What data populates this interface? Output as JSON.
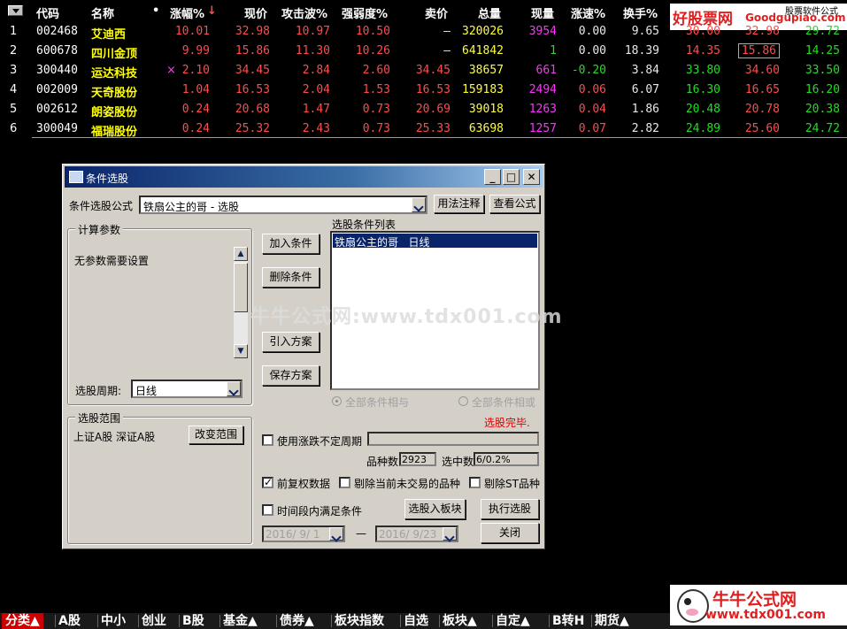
{
  "table": {
    "headers": {
      "code": "代码",
      "name": "名称",
      "dot": "•",
      "change_pct": "涨幅%",
      "sort_mark": "↓",
      "price": "现价",
      "attack_wave": "攻击波%",
      "strength": "强弱度%",
      "ask": "卖价",
      "volume": "总量",
      "cur_volume": "现量",
      "speed": "涨速%",
      "turnover": "换手%"
    },
    "rows": [
      {
        "idx": "1",
        "code": "002468",
        "name": "艾迪西",
        "mark": "",
        "chg": "10.01",
        "price": "32.98",
        "attack": "10.97",
        "strength": "10.50",
        "ask": "—",
        "vol": "320026",
        "cur": "3954",
        "speed": "0.00",
        "turn": "9.65",
        "c1": "30.00",
        "c2": "32.98",
        "c3": "29.72"
      },
      {
        "idx": "2",
        "code": "600678",
        "name": "四川金顶",
        "mark": "",
        "chg": "9.99",
        "price": "15.86",
        "attack": "11.30",
        "strength": "10.26",
        "ask": "—",
        "vol": "641842",
        "cur": "1",
        "speed": "0.00",
        "turn": "18.39",
        "c1": "14.35",
        "c2": "15.86",
        "c3": "14.25"
      },
      {
        "idx": "3",
        "code": "300440",
        "name": "运达科技",
        "mark": "×",
        "chg": "2.10",
        "price": "34.45",
        "attack": "2.84",
        "strength": "2.60",
        "ask": "34.45",
        "vol": "38657",
        "cur": "661",
        "speed": "-0.20",
        "turn": "3.84",
        "c1": "33.80",
        "c2": "34.60",
        "c3": "33.50"
      },
      {
        "idx": "4",
        "code": "002009",
        "name": "天奇股份",
        "mark": "",
        "chg": "1.04",
        "price": "16.53",
        "attack": "2.04",
        "strength": "1.53",
        "ask": "16.53",
        "vol": "159183",
        "cur": "2494",
        "speed": "0.06",
        "turn": "6.07",
        "c1": "16.30",
        "c2": "16.65",
        "c3": "16.20"
      },
      {
        "idx": "5",
        "code": "002612",
        "name": "朗姿股份",
        "mark": "",
        "chg": "0.24",
        "price": "20.68",
        "attack": "1.47",
        "strength": "0.73",
        "ask": "20.69",
        "vol": "39018",
        "cur": "1263",
        "speed": "0.04",
        "turn": "1.86",
        "c1": "20.48",
        "c2": "20.78",
        "c3": "20.38"
      },
      {
        "idx": "6",
        "code": "300049",
        "name": "福瑞股份",
        "mark": "",
        "chg": "0.24",
        "price": "25.32",
        "attack": "2.43",
        "strength": "0.73",
        "ask": "25.33",
        "vol": "63698",
        "cur": "1257",
        "speed": "0.07",
        "turn": "2.82",
        "c1": "24.89",
        "c2": "25.60",
        "c3": "24.72"
      }
    ]
  },
  "top_logo": {
    "brand": "好股票网",
    "domain": "Goodgupiao.com",
    "tag": "股票软件公式"
  },
  "dialog": {
    "title": "条件选股",
    "formula_label": "条件选股公式",
    "formula_value": "铁扇公主的哥 - 选股",
    "usage_button": "用法注释",
    "view_formula_button": "查看公式",
    "calc_params_title": "计算参数",
    "no_params_text": "无参数需要设置",
    "period_label": "选股周期:",
    "period_value": "日线",
    "add_condition": "加入条件",
    "delete_condition": "删除条件",
    "import_plan": "引入方案",
    "save_plan": "保存方案",
    "condition_list_title": "选股条件列表",
    "condition_items": [
      "铁扇公主的哥   日线"
    ],
    "radio_and": "全部条件相与",
    "radio_or": "全部条件相或",
    "status": "选股完毕.",
    "range_title": "选股范围",
    "range_value": "上证A股 深证A股",
    "change_range": "改变范围",
    "use_cycle": "使用涨跌不定周期",
    "count_label": "品种数",
    "count_value": "2923",
    "selected_label": "选中数",
    "selected_value": "6/0.2%",
    "adjusted_data": "前复权数据",
    "exclude_untraded": "剔除当前未交易的品种",
    "exclude_st": "剔除ST品种",
    "time_range_cond": "时间段内满足条件",
    "to_block": "选股入板块",
    "execute": "执行选股",
    "close": "关闭",
    "date_from": "2016/ 9/ 1",
    "date_sep": "—",
    "date_to": "2016/ 9/23"
  },
  "watermark": "牛牛公式网:www.tdx001.com",
  "bottom_tabs": [
    "分类▲",
    "A股",
    "中小",
    "创业",
    "B股",
    "基金▲",
    "债券▲",
    "板块指数",
    "自选",
    "板块▲",
    "自定▲",
    "B转H",
    "期货▲"
  ],
  "bottom_logo": {
    "brand": "牛牛公式网",
    "domain": "www.tdx001.com"
  },
  "colors": {
    "up": "#ff4c4c",
    "down": "#22dd22",
    "name": "#ffff00",
    "volume": "#ffff33",
    "cur_volume": "#ff33ff",
    "title_bar": "#0a246a",
    "dialog_bg": "#d4d0c8"
  }
}
